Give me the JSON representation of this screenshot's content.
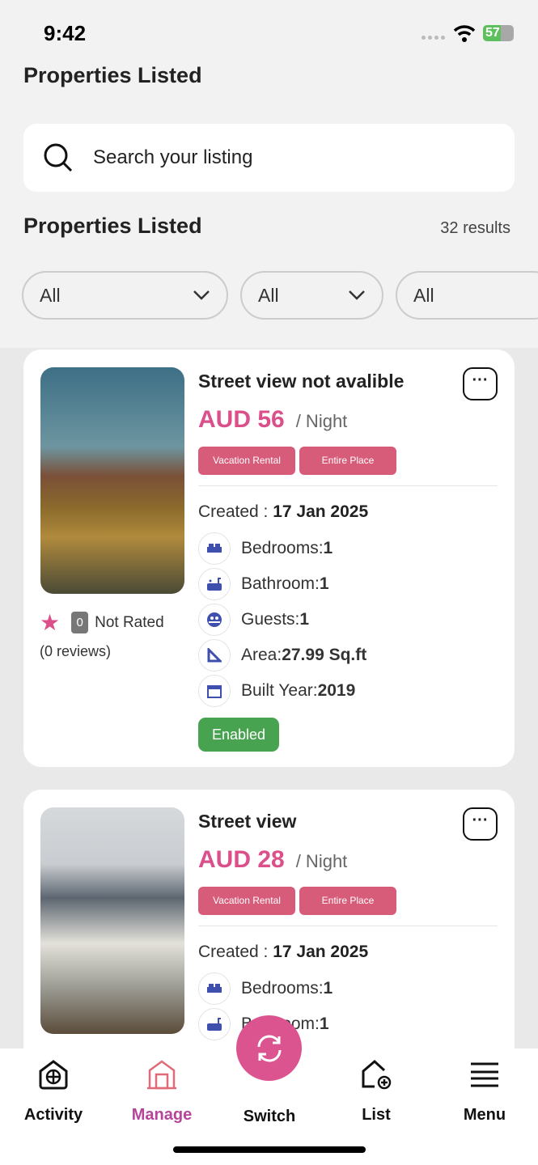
{
  "status": {
    "time": "9:42",
    "battery": "57",
    "battery_level": 57
  },
  "header": {
    "title": "Properties Listed"
  },
  "search": {
    "placeholder": "Search your listing"
  },
  "section": {
    "title": "Properties Listed",
    "results": "32 results"
  },
  "filters": [
    "All",
    "All",
    "All"
  ],
  "colors": {
    "accent": "#db4f8a",
    "tag": "#d65c7a",
    "enabled": "#47a350",
    "icon": "#3f4fae"
  },
  "listings": [
    {
      "title": "Street view not avalible",
      "price": "AUD 56",
      "unit": "/ Night",
      "tags": [
        "Vacation Rental",
        "Entire Place"
      ],
      "created_label": "Created : ",
      "created": "17 Jan 2025",
      "features": [
        {
          "icon": "bed-icon",
          "label": "Bedrooms: ",
          "value": "1"
        },
        {
          "icon": "bathtub-icon",
          "label": "Bathroom: ",
          "value": "1"
        },
        {
          "icon": "guests-icon",
          "label": "Guests: ",
          "value": "1"
        },
        {
          "icon": "area-icon",
          "label": "Area: ",
          "value": "27.99 Sq.ft"
        },
        {
          "icon": "calendar-icon",
          "label": "Built Year: ",
          "value": "2019"
        }
      ],
      "rating": "0",
      "rating_label": "Not Rated",
      "reviews": "(0 reviews)",
      "status": "Enabled"
    },
    {
      "title": "Street view",
      "price": "AUD 28",
      "unit": "/ Night",
      "tags": [
        "Vacation Rental",
        "Entire Place"
      ],
      "created_label": "Created : ",
      "created": "17 Jan 2025",
      "features": [
        {
          "icon": "bed-icon",
          "label": "Bedrooms: ",
          "value": "1"
        },
        {
          "icon": "bathtub-icon",
          "label": "Bathroom: ",
          "value": "1"
        }
      ]
    }
  ],
  "nav": [
    {
      "label": "Activity",
      "icon": "house-grid-icon"
    },
    {
      "label": "Manage",
      "icon": "barn-icon",
      "active": true
    },
    {
      "label": "Switch",
      "icon": "refresh-icon"
    },
    {
      "label": "List",
      "icon": "house-add-icon"
    },
    {
      "label": "Menu",
      "icon": "menu-icon"
    }
  ]
}
